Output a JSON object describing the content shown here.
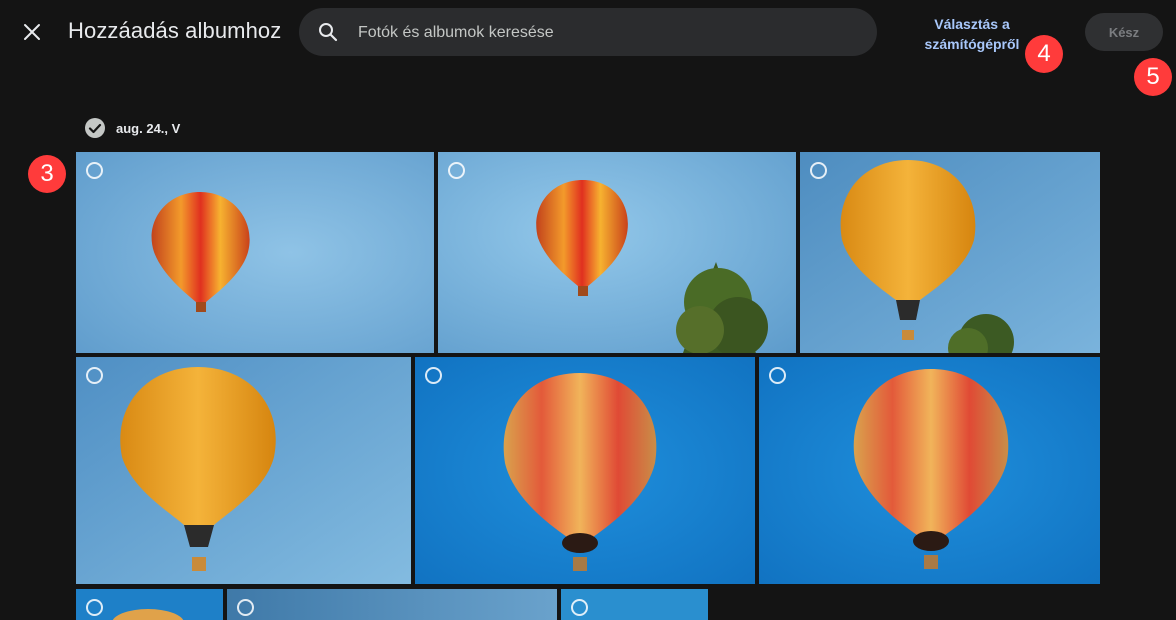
{
  "header": {
    "title": "Hozzáadás albumhoz",
    "search_placeholder": "Fotók és albumok keresése",
    "select_from_computer": "Választás a számítógépről",
    "done_label": "Kész"
  },
  "annotations": {
    "badge_3": "3",
    "badge_4": "4",
    "badge_5": "5"
  },
  "date_group": {
    "label": "aug. 24., V"
  },
  "icons": {
    "close": "close-icon",
    "search": "search-icon",
    "group_check": "check-circle-icon",
    "photo_select": "radio-circle-icon"
  },
  "photos_row1": [
    {
      "subject": "red-orange balloon in light blue sky"
    },
    {
      "subject": "red-orange balloon with tree"
    },
    {
      "subject": "MVM Sportegyesület yellow balloon with tree"
    }
  ],
  "photos_row2": [
    {
      "subject": "MVM Sportegyesület yellow balloon"
    },
    {
      "subject": "striped balloon from below"
    },
    {
      "subject": "striped balloon from below"
    }
  ],
  "photos_row3": [
    {
      "subject": "balloon partial"
    },
    {
      "subject": "sky partial"
    },
    {
      "subject": "sky partial"
    }
  ],
  "colors": {
    "background": "#141414",
    "search_bg": "#2b2c2e",
    "link": "#a8c7fa",
    "badge": "#ff3b3b"
  }
}
